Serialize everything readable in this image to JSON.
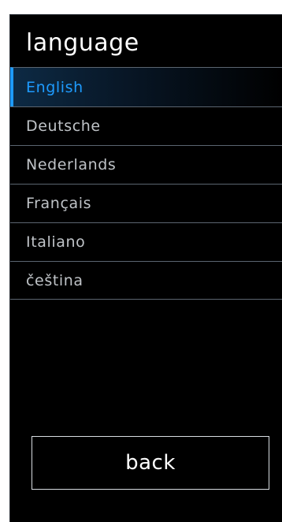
{
  "header": {
    "title": "language"
  },
  "languages": [
    {
      "label": "English",
      "selected": true
    },
    {
      "label": "Deutsche",
      "selected": false
    },
    {
      "label": "Nederlands",
      "selected": false
    },
    {
      "label": "Français",
      "selected": false
    },
    {
      "label": "Italiano",
      "selected": false
    },
    {
      "label": "čeština",
      "selected": false
    }
  ],
  "footer": {
    "back_label": "back"
  },
  "colors": {
    "background": "#000000",
    "accent": "#1e9bff",
    "text": "#bfc3c7",
    "divider": "#5b6570"
  }
}
